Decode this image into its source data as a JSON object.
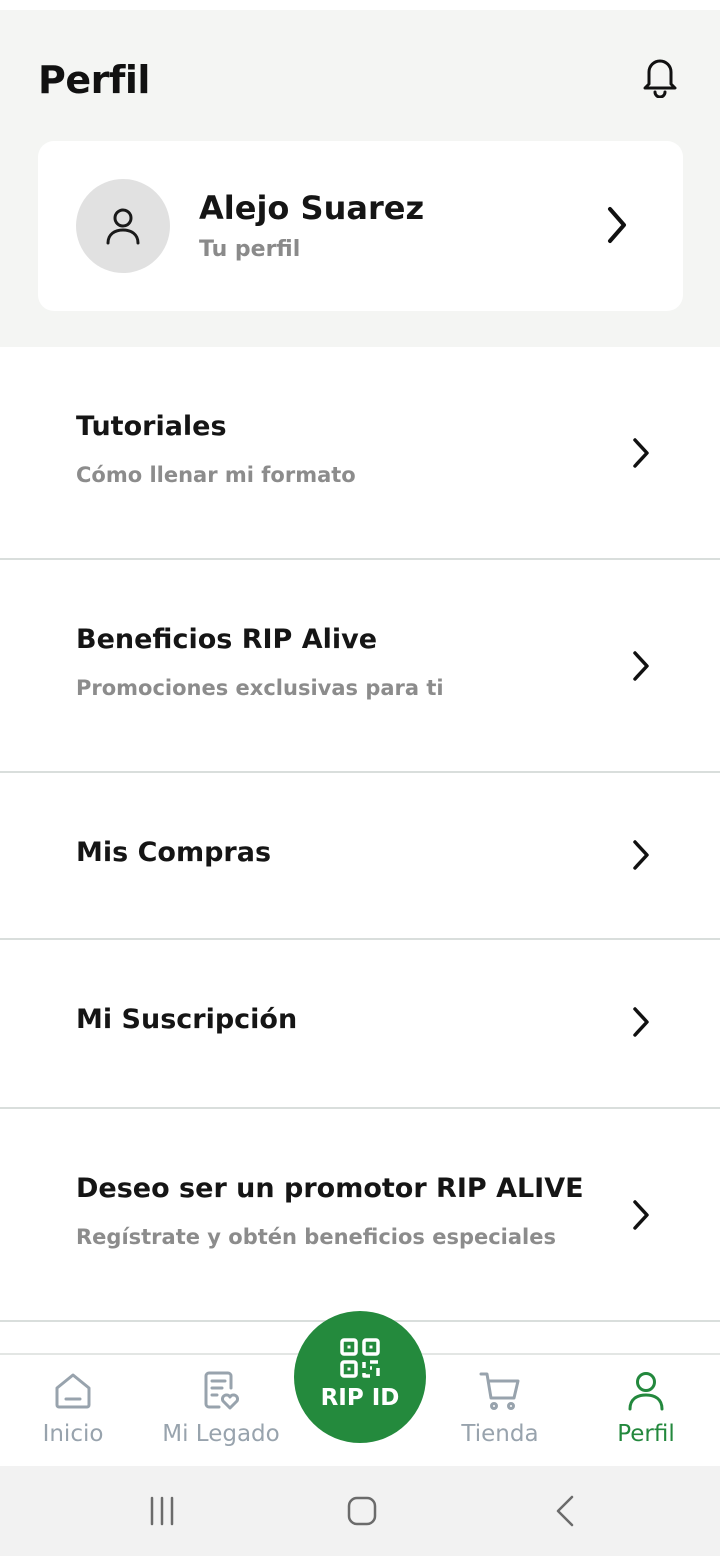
{
  "header": {
    "title": "Perfil",
    "notification_icon": "bell-icon"
  },
  "profile": {
    "name": "Alejo Suarez",
    "subtitle": "Tu perfil",
    "avatar_icon": "user-icon"
  },
  "menu": [
    {
      "title": "Tutoriales",
      "subtitle": "Cómo llenar mi formato"
    },
    {
      "title": "Beneficios RIP Alive",
      "subtitle": "Promociones exclusivas para ti"
    },
    {
      "title": "Mis Compras",
      "subtitle": ""
    },
    {
      "title": "Mi Suscripción",
      "subtitle": ""
    },
    {
      "title": "Deseo ser un promotor RIP ALIVE",
      "subtitle": "Regístrate  y obtén beneficios especiales"
    }
  ],
  "bottom_nav": {
    "items": [
      {
        "label": "Inicio",
        "icon": "home-icon",
        "active": false
      },
      {
        "label": "Mi Legado",
        "icon": "document-heart-icon",
        "active": false
      },
      {
        "label": "Tienda",
        "icon": "cart-icon",
        "active": false
      },
      {
        "label": "Perfil",
        "icon": "user-icon",
        "active": true
      }
    ],
    "center_button": {
      "label": "RIP ID",
      "icon": "qr-code-icon"
    }
  },
  "colors": {
    "accent_green": "#248a3d",
    "header_bg": "#f4f5f3",
    "muted_text": "#8c8c8c",
    "inactive_nav": "#98a3ad"
  }
}
